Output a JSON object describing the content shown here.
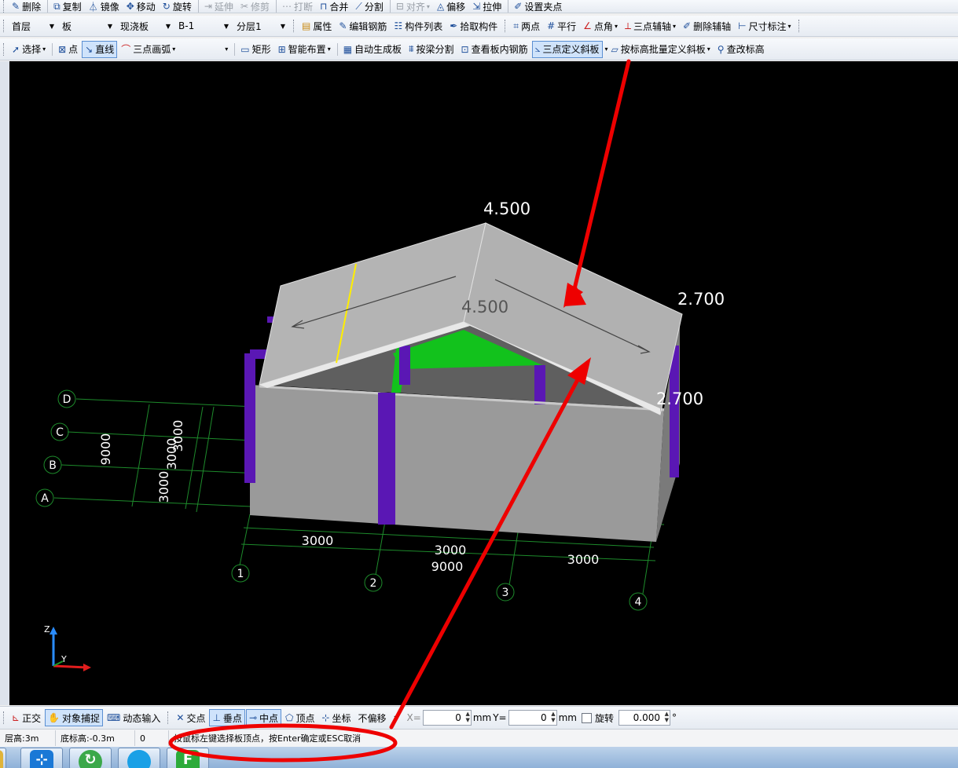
{
  "toolbar_edit": {
    "delete": "删除",
    "copy": "复制",
    "mirror": "镜像",
    "move": "移动",
    "rotate": "旋转",
    "extend": "延伸",
    "trim": "修剪",
    "break": "打断",
    "merge": "合并",
    "split": "分割",
    "align": "对齐",
    "offset": "偏移",
    "stretch": "拉伸",
    "set_grip": "设置夹点"
  },
  "toolbar_prop": {
    "floor": "首层",
    "type": "板",
    "subtype": "现浇板",
    "name": "B-1",
    "layer": "分层1",
    "properties": "属性",
    "edit_rebar": "编辑钢筋",
    "component_list": "构件列表",
    "pick_component": "拾取构件",
    "two_points": "两点",
    "parallel": "平行",
    "point_angle": "点角",
    "three_point_axis": "三点辅轴",
    "delete_axis": "删除辅轴",
    "dimension": "尺寸标注"
  },
  "toolbar_draw": {
    "select": "选择",
    "point": "点",
    "line": "直线",
    "arc": "三点画弧",
    "rect": "矩形",
    "smart_layout": "智能布置",
    "auto_slab": "自动生成板",
    "split_by_beam": "按梁分割",
    "view_slab_rebar": "查看板内钢筋",
    "three_point_slope": "三点定义斜板",
    "batch_slope": "按标高批量定义斜板",
    "change_elev": "查改标高"
  },
  "viewport": {
    "elevations": {
      "ridge_far": "4.500",
      "ridge_near": "4.500",
      "eave_far": "2.700",
      "eave_near": "2.700"
    },
    "axes_rows": [
      "D",
      "C",
      "B",
      "A"
    ],
    "axes_cols": [
      "1",
      "2",
      "3",
      "4"
    ],
    "dims_rows": [
      "3000",
      "3000",
      "3000"
    ],
    "dim_rows_total": "9000",
    "dims_cols": [
      "3000",
      "3000",
      "3000"
    ],
    "dim_cols_total": "9000",
    "coord_z": "Z",
    "coord_y": "Y"
  },
  "status": {
    "ortho": "正交",
    "snap": "对象捕捉",
    "dynamic_input": "动态输入",
    "intersection": "交点",
    "perpendicular": "垂点",
    "midpoint": "中点",
    "vertex": "顶点",
    "coordinate": "坐标",
    "no_offset": "不偏移",
    "x_label": "X=",
    "x_value": "0",
    "x_unit": "mm",
    "y_label": "Y=",
    "y_value": "0",
    "y_unit": "mm",
    "rotate_label": "旋转",
    "rotate_value": "0.000",
    "degree": "°"
  },
  "info": {
    "floor_height": "层高:3m",
    "bottom_elevation": "底标高:-0.3m",
    "value": "0",
    "prompt": "按鼠标左键选择板顶点，按Enter确定或ESC取消"
  },
  "colors": {
    "viewport_bg": "#000000",
    "annotation": "#ff0000",
    "slab": "#b4b4b4",
    "column": "#5a17b4",
    "grid": "#1a8c1a"
  }
}
